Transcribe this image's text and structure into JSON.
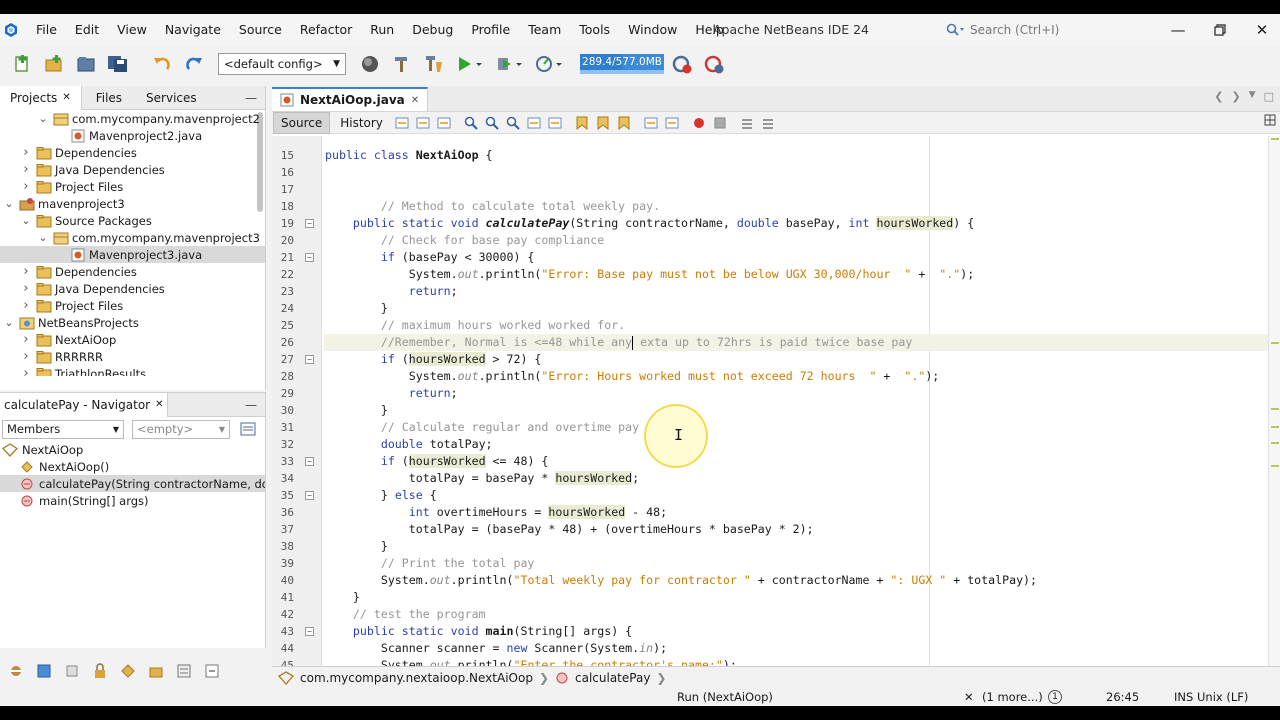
{
  "app": {
    "title": "Apache NetBeans IDE 24",
    "search_placeholder": "Search (Ctrl+I)"
  },
  "menu": [
    "File",
    "Edit",
    "View",
    "Navigate",
    "Source",
    "Refactor",
    "Run",
    "Debug",
    "Profile",
    "Team",
    "Tools",
    "Window",
    "Help"
  ],
  "toolbar": {
    "config": "<default config>",
    "memory": "289.4/577.0MB",
    "memory_fraction": 0.5
  },
  "projects_panel": {
    "tabs": [
      "Projects",
      "Files",
      "Services"
    ],
    "tree": [
      {
        "label": "com.mycompany.mavenproject2",
        "indent": 2,
        "expanded": true,
        "icon": "package-icon"
      },
      {
        "label": "Mavenproject2.java",
        "indent": 3,
        "icon": "java-file-icon"
      },
      {
        "label": "Dependencies",
        "indent": 1,
        "expanded": false,
        "icon": "folder-icon"
      },
      {
        "label": "Java Dependencies",
        "indent": 1,
        "expanded": false,
        "icon": "folder-icon"
      },
      {
        "label": "Project Files",
        "indent": 1,
        "expanded": false,
        "icon": "folder-icon"
      },
      {
        "label": "mavenproject3",
        "indent": 0,
        "expanded": true,
        "icon": "maven-project-icon"
      },
      {
        "label": "Source Packages",
        "indent": 1,
        "expanded": true,
        "icon": "folder-icon"
      },
      {
        "label": "com.mycompany.mavenproject3",
        "indent": 2,
        "expanded": true,
        "icon": "package-icon"
      },
      {
        "label": "Mavenproject3.java",
        "indent": 3,
        "icon": "java-file-icon",
        "selected": true
      },
      {
        "label": "Dependencies",
        "indent": 1,
        "expanded": false,
        "icon": "folder-icon"
      },
      {
        "label": "Java Dependencies",
        "indent": 1,
        "expanded": false,
        "icon": "folder-icon"
      },
      {
        "label": "Project Files",
        "indent": 1,
        "expanded": false,
        "icon": "folder-icon"
      },
      {
        "label": "NetBeansProjects",
        "indent": 0,
        "expanded": true,
        "icon": "project-group-icon"
      },
      {
        "label": "NextAiOop",
        "indent": 1,
        "expanded": false,
        "icon": "folder-icon"
      },
      {
        "label": "RRRRRR",
        "indent": 1,
        "expanded": false,
        "icon": "folder-icon"
      },
      {
        "label": "TriathlonResults",
        "indent": 1,
        "expanded": false,
        "icon": "folder-icon"
      }
    ]
  },
  "navigator": {
    "tab": "calculatePay - Navigator",
    "filter_members": "Members",
    "filter_empty": "<empty>",
    "items": [
      {
        "label": "NextAiOop",
        "indent": 0,
        "icon": "class-icon"
      },
      {
        "label": "NextAiOop()",
        "indent": 1,
        "icon": "constructor-icon"
      },
      {
        "label": "calculatePay(String contractorName, double basePay, int hoursWorked)",
        "indent": 1,
        "icon": "static-method-icon",
        "selected": true
      },
      {
        "label": "main(String[] args)",
        "indent": 1,
        "icon": "static-method-icon"
      }
    ]
  },
  "editor": {
    "tab": "NextAiOop.java",
    "views": [
      "Source",
      "History"
    ],
    "lines": [
      {
        "n": "15",
        "tokens": [
          [
            "",
            "public "
          ],
          [
            "kw",
            ""
          ],
          [
            "",
            ""
          ]
        ],
        "raw": true
      },
      {
        "n": "16"
      },
      {
        "n": "17"
      },
      {
        "n": "18"
      },
      {
        "n": "19"
      },
      {
        "n": "20"
      },
      {
        "n": "21"
      },
      {
        "n": "22"
      },
      {
        "n": "23"
      },
      {
        "n": "24"
      },
      {
        "n": "25"
      },
      {
        "n": "26"
      },
      {
        "n": "27"
      },
      {
        "n": "28"
      },
      {
        "n": "29"
      },
      {
        "n": "30"
      },
      {
        "n": "31"
      },
      {
        "n": "32"
      },
      {
        "n": "33"
      },
      {
        "n": "34"
      },
      {
        "n": "35"
      },
      {
        "n": "36"
      },
      {
        "n": "37"
      },
      {
        "n": "38"
      },
      {
        "n": "39"
      },
      {
        "n": "40"
      },
      {
        "n": "41"
      },
      {
        "n": "42"
      },
      {
        "n": "43"
      },
      {
        "n": "44"
      },
      {
        "n": "45"
      }
    ],
    "code": [
      {
        "n": "15",
        "fold": false,
        "t": [
          [
            "kw",
            "public class "
          ],
          [
            "mthb",
            "NextAiOop"
          ],
          [
            "",
            " {"
          ]
        ]
      },
      {
        "n": "16",
        "fold": false,
        "t": []
      },
      {
        "n": "17",
        "fold": false,
        "t": []
      },
      {
        "n": "18",
        "fold": false,
        "t": [
          [
            "",
            "        "
          ],
          [
            "cm",
            "// Method to calculate total weekly pay."
          ]
        ]
      },
      {
        "n": "19",
        "fold": true,
        "t": [
          [
            "",
            "    "
          ],
          [
            "kw",
            "public static void "
          ],
          [
            "mth",
            "calculatePay"
          ],
          [
            "",
            "("
          ],
          [
            "kw",
            ""
          ],
          [
            "",
            "String contractorName, "
          ],
          [
            "kw",
            "double"
          ],
          [
            "",
            " basePay, "
          ],
          [
            "kw",
            "int"
          ],
          [
            "",
            " "
          ],
          [
            "occ",
            "hoursWorked"
          ],
          [
            "",
            ") {"
          ]
        ]
      },
      {
        "n": "20",
        "fold": false,
        "t": [
          [
            "",
            "        "
          ],
          [
            "cm",
            "// Check for base pay compliance"
          ]
        ]
      },
      {
        "n": "21",
        "fold": true,
        "t": [
          [
            "",
            "        "
          ],
          [
            "kw",
            "if"
          ],
          [
            "",
            " (basePay < 30000) {"
          ]
        ]
      },
      {
        "n": "22",
        "fold": false,
        "t": [
          [
            "",
            "            System."
          ],
          [
            "fld",
            "out"
          ],
          [
            "",
            ".println("
          ],
          [
            "st",
            "\"Error: Base pay must not be below UGX 30,000/hour  \""
          ],
          [
            "",
            " +  "
          ],
          [
            "st",
            "\".\""
          ],
          [
            "",
            ");"
          ]
        ]
      },
      {
        "n": "23",
        "fold": false,
        "t": [
          [
            "",
            "            "
          ],
          [
            "kw",
            "return"
          ],
          [
            "",
            ";"
          ]
        ]
      },
      {
        "n": "24",
        "fold": false,
        "t": [
          [
            "",
            "        }"
          ]
        ]
      },
      {
        "n": "25",
        "fold": false,
        "t": [
          [
            "",
            "        "
          ],
          [
            "cm",
            "// maximum hours worked worked for."
          ]
        ]
      },
      {
        "n": "26",
        "fold": false,
        "hl": true,
        "caret": true,
        "t": [
          [
            "",
            "        "
          ],
          [
            "cm",
            "//Remember, Normal is <=48 while any"
          ],
          [
            "caret",
            ""
          ],
          [
            "cm",
            " exta up to 72hrs is paid twice base pay"
          ]
        ]
      },
      {
        "n": "27",
        "fold": true,
        "t": [
          [
            "",
            "        "
          ],
          [
            "kw",
            "if"
          ],
          [
            "",
            " ("
          ],
          [
            "occ",
            "hoursWorked"
          ],
          [
            "",
            " > 72) {"
          ]
        ]
      },
      {
        "n": "28",
        "fold": false,
        "t": [
          [
            "",
            "            System."
          ],
          [
            "fld",
            "out"
          ],
          [
            "",
            ".println("
          ],
          [
            "st",
            "\"Error: Hours worked must not exceed 72 hours  \""
          ],
          [
            "",
            " +  "
          ],
          [
            "st",
            "\".\""
          ],
          [
            "",
            ");"
          ]
        ]
      },
      {
        "n": "29",
        "fold": false,
        "t": [
          [
            "",
            "            "
          ],
          [
            "kw",
            "return"
          ],
          [
            "",
            ";"
          ]
        ]
      },
      {
        "n": "30",
        "fold": false,
        "t": [
          [
            "",
            "        }"
          ]
        ]
      },
      {
        "n": "31",
        "fold": false,
        "t": [
          [
            "",
            "        "
          ],
          [
            "cm",
            "// Calculate regular and overtime pay"
          ]
        ]
      },
      {
        "n": "32",
        "fold": false,
        "t": [
          [
            "",
            "        "
          ],
          [
            "kw",
            "double"
          ],
          [
            "",
            " totalPay;"
          ]
        ]
      },
      {
        "n": "33",
        "fold": true,
        "t": [
          [
            "",
            "        "
          ],
          [
            "kw",
            "if"
          ],
          [
            "",
            " ("
          ],
          [
            "occ",
            "hoursWorked"
          ],
          [
            "",
            " <= 48) {"
          ]
        ]
      },
      {
        "n": "34",
        "fold": false,
        "t": [
          [
            "",
            "            totalPay = basePay * "
          ],
          [
            "occ",
            "hoursWorked"
          ],
          [
            "",
            ";"
          ]
        ]
      },
      {
        "n": "35",
        "fold": true,
        "t": [
          [
            "",
            "        } "
          ],
          [
            "kw",
            "else"
          ],
          [
            "",
            " {"
          ]
        ]
      },
      {
        "n": "36",
        "fold": false,
        "t": [
          [
            "",
            "            "
          ],
          [
            "kw",
            "int"
          ],
          [
            "",
            " overtimeHours = "
          ],
          [
            "occ",
            "hoursWorked"
          ],
          [
            "",
            " - 48;"
          ]
        ]
      },
      {
        "n": "37",
        "fold": false,
        "t": [
          [
            "",
            "            totalPay = (basePay * 48) + (overtimeHours * basePay * 2);"
          ]
        ]
      },
      {
        "n": "38",
        "fold": false,
        "t": [
          [
            "",
            "        }"
          ]
        ]
      },
      {
        "n": "39",
        "fold": false,
        "t": [
          [
            "",
            "        "
          ],
          [
            "cm",
            "// Print the total pay"
          ]
        ]
      },
      {
        "n": "40",
        "fold": false,
        "t": [
          [
            "",
            "        System."
          ],
          [
            "fld",
            "out"
          ],
          [
            "",
            ".println("
          ],
          [
            "st",
            "\"Total weekly pay for contractor \""
          ],
          [
            "",
            " + contractorName + "
          ],
          [
            "st",
            "\": UGX \""
          ],
          [
            "",
            " + totalPay);"
          ]
        ]
      },
      {
        "n": "41",
        "fold": false,
        "t": [
          [
            "",
            "    }"
          ]
        ]
      },
      {
        "n": "42",
        "fold": false,
        "t": [
          [
            "",
            "    "
          ],
          [
            "cm",
            "// test the program"
          ]
        ]
      },
      {
        "n": "43",
        "fold": true,
        "t": [
          [
            "",
            "    "
          ],
          [
            "kw",
            "public static void "
          ],
          [
            "mthb",
            "main"
          ],
          [
            "",
            "(String[] args) {"
          ]
        ]
      },
      {
        "n": "44",
        "fold": false,
        "t": [
          [
            "",
            "        Scanner scanner = "
          ],
          [
            "kw",
            "new"
          ],
          [
            "",
            " Scanner(System."
          ],
          [
            "fld",
            "in"
          ],
          [
            "",
            ");"
          ]
        ]
      },
      {
        "n": "45",
        "fold": false,
        "t": [
          [
            "",
            "        System."
          ],
          [
            "fld",
            "out"
          ],
          [
            "",
            ".println("
          ],
          [
            "st",
            "\"Enter the contractor's name:\""
          ],
          [
            "",
            ");"
          ]
        ]
      }
    ]
  },
  "breadcrumb": [
    "com.mycompany.nextaioop.NextAiOop",
    "calculatePay"
  ],
  "status": {
    "run": "Run (NextAiOop)",
    "more": "(1 more...)",
    "notifications": "1",
    "position": "26:45",
    "mode": "INS",
    "eol": "Unix (LF)"
  },
  "colors": {
    "accent": "#3d7fd6",
    "keyword": "#2a3fb5",
    "comment": "#969696",
    "string": "#ce7b00"
  }
}
